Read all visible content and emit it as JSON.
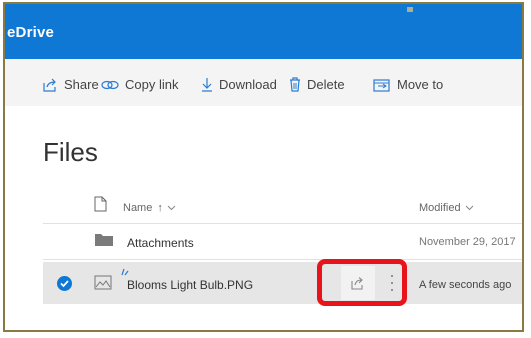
{
  "app": {
    "title": "eDrive"
  },
  "toolbar": {
    "share_label": "Share",
    "copy_link_label": "Copy link",
    "download_label": "Download",
    "delete_label": "Delete",
    "move_to_label": "Move to"
  },
  "page": {
    "title": "Files"
  },
  "table": {
    "columns": {
      "name": "Name",
      "sort_indicator": "↑",
      "modified": "Modified"
    },
    "rows": [
      {
        "name": "Attachments",
        "modified": "November 29, 2017",
        "type": "folder-icon",
        "selected": false
      },
      {
        "name": "Blooms Light Bulb.PNG",
        "modified": "A few seconds ago",
        "type": "image-file-icon",
        "selected": true
      }
    ]
  },
  "colors": {
    "brand": "#0f78d4",
    "highlight": "#e8141c",
    "selected_row": "#e6e6e6",
    "command_bar": "#f4f4f4"
  }
}
